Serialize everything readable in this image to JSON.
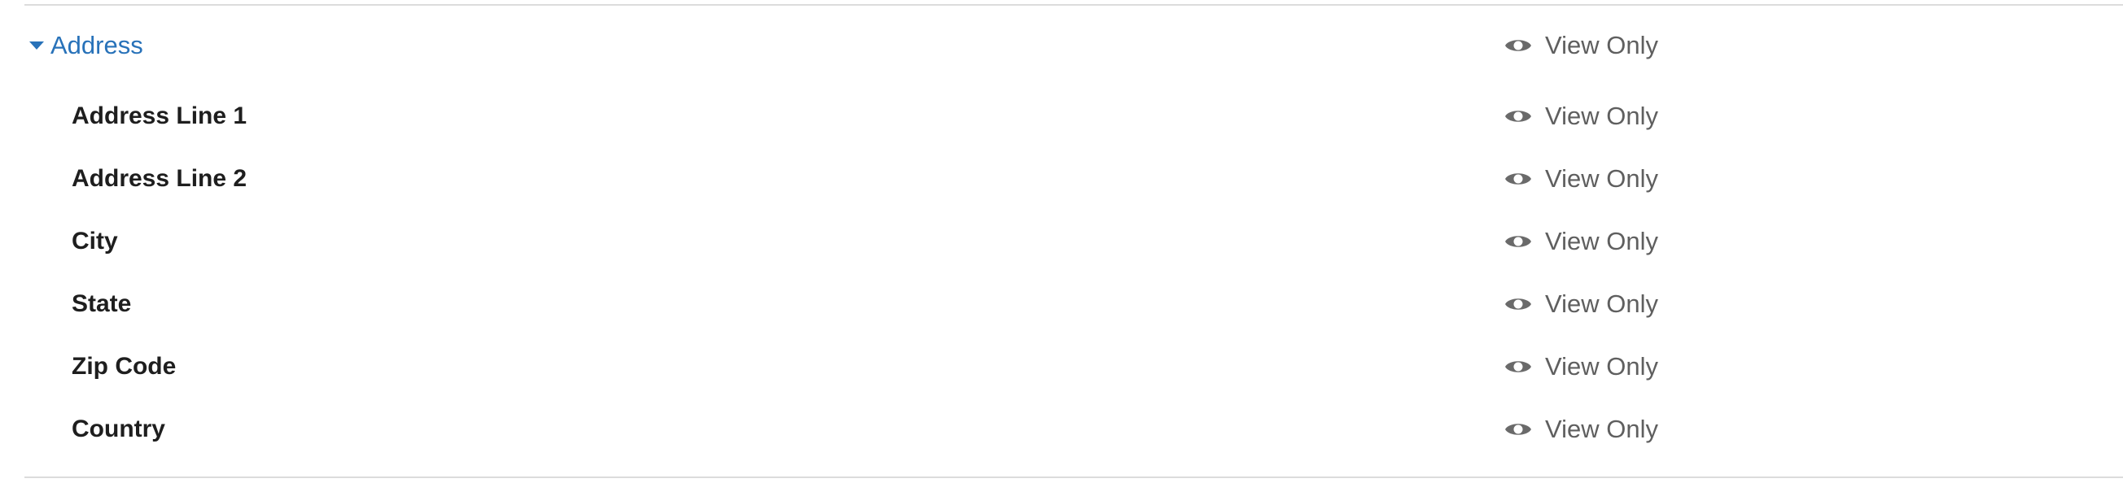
{
  "group": {
    "title": "Address",
    "permission": "View Only",
    "permission_icon": "eye-icon",
    "accent_color": "#2872b9"
  },
  "fields": [
    {
      "label": "Address Line 1",
      "permission": "View Only"
    },
    {
      "label": "Address Line 2",
      "permission": "View Only"
    },
    {
      "label": "City",
      "permission": "View Only"
    },
    {
      "label": "State",
      "permission": "View Only"
    },
    {
      "label": "Zip Code",
      "permission": "View Only"
    },
    {
      "label": "Country",
      "permission": "View Only"
    }
  ]
}
